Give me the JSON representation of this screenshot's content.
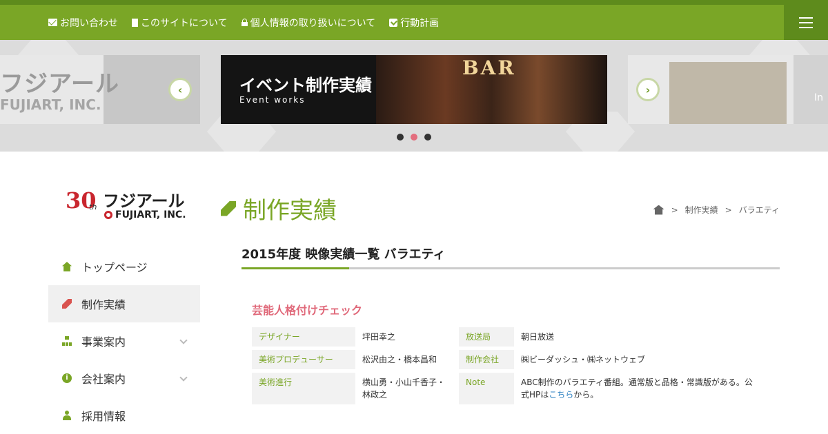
{
  "topnav": [
    {
      "label": "お問い合わせ",
      "icon": "envelope-icon"
    },
    {
      "label": "このサイトについて",
      "icon": "file-icon"
    },
    {
      "label": "個人情報の取り扱いについて",
      "icon": "lock-icon"
    },
    {
      "label": "行動計画",
      "icon": "check-square-icon"
    }
  ],
  "slider": {
    "left_logo_jp": "フジアール",
    "left_logo_en": "FUJIART, INC.",
    "center_title": "イベント制作実績",
    "center_sub": "Event works",
    "center_sign": "BAR",
    "right_peek": "In"
  },
  "logo": {
    "num": "30",
    "th": "th",
    "jp": "フジアール",
    "en": "FUJIART, INC."
  },
  "sidenav": [
    {
      "label": "トップページ",
      "icon": "home-icon",
      "has_sub": false
    },
    {
      "label": "制作実績",
      "icon": "wrench-icon",
      "has_sub": false,
      "active": true
    },
    {
      "label": "事業案内",
      "icon": "sitemap-icon",
      "has_sub": true
    },
    {
      "label": "会社案内",
      "icon": "info-icon",
      "has_sub": true
    },
    {
      "label": "採用情報",
      "icon": "user-icon",
      "has_sub": false
    }
  ],
  "page": {
    "title": "制作実績",
    "breadcrumb": [
      "制作実績",
      "バラエティ"
    ],
    "breadcrumb_sep": ">",
    "section_title": "2015年度 映像実績一覧 バラエティ"
  },
  "work": {
    "title": "芸能人格付けチェック",
    "designer_label": "デザイナー",
    "designer": "坪田幸之",
    "producer_label": "美術プロデューサー",
    "producer": "松沢由之・橋本昌和",
    "progress_label": "美術進行",
    "progress_line1": "横山勇・小山千香子・",
    "progress_line2": "林政之",
    "station_label": "放送局",
    "station": "朝日放送",
    "company_label": "制作会社",
    "company": "㈱ビーダッシュ・㈱ネットウェブ",
    "note_label": "Note",
    "note_line1": "ABC制作のバラエティ番組。通常版と品格・常識版がある。公",
    "note_line2_pre": "式HPは",
    "note_link": "こちら",
    "note_line2_post": "から。"
  },
  "colors": {
    "brand": "#7aa626",
    "brand_dark": "#5e8b1c",
    "accent_pink": "#e0697a"
  }
}
